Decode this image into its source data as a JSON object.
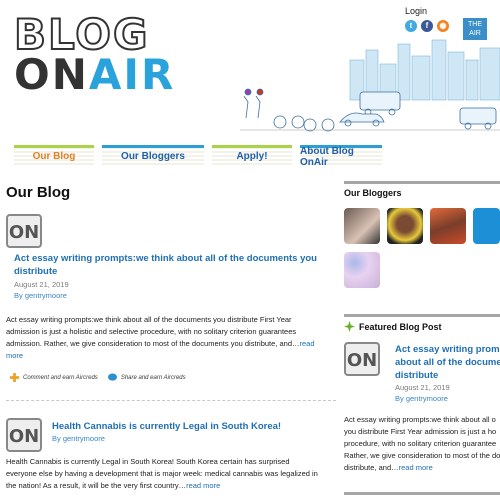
{
  "header": {
    "logo_line1": "BLOG",
    "logo_on": "ON",
    "logo_air": "AIR",
    "login_label": "Login",
    "social": [
      "twitter-icon",
      "facebook-icon",
      "rss-icon"
    ],
    "badge_line1": "THE",
    "badge_line2": "AIR"
  },
  "nav": {
    "tabs": [
      "Our Blog",
      "Our Bloggers",
      "Apply!",
      "About Blog OnAir"
    ]
  },
  "main": {
    "title": "Our Blog",
    "posts": [
      {
        "title_line1": "Act essay writing prompts:we think about all of the documents you",
        "title_line2": "distribute",
        "date": "August 21, 2019",
        "author": "By gentrymoore",
        "excerpt_lines": [
          "Act essay writing prompts:we think about all of the documents you distribute First Year",
          "admission is just a holistic and selective procedure, with no solitary criterion guarantees",
          "admission. Rather, we give consideration to most of the documents you distribute, and…"
        ],
        "read_more_inline": "read",
        "read_more_tail": "more",
        "comment_label": "Comment and earn Aircreds",
        "share_label": "Share and earn Aircreds"
      },
      {
        "title": "Health Cannabis is currently Legal in South Korea!",
        "author": "By gentrymoore",
        "excerpt_lines": [
          "Health Cannabis is currently Legal in South Korea! South Korea certain has surprised",
          "everyone else by having a development that is major week: medical cannabis was legalized in",
          "the nation! As a result, it will be the very first country…"
        ],
        "read_more": "read more"
      }
    ]
  },
  "sidebar": {
    "bloggers_title": "Our Bloggers",
    "featured_title": "Featured Blog Post",
    "featured": {
      "title_lines": [
        "Act essay writing promp",
        "about all of the docume",
        "distribute"
      ],
      "date": "August 21, 2019",
      "author": "By gentrymoore",
      "excerpt_lines": [
        "Act essay writing prompts:we think about all o",
        "you distribute First Year admission is just a ho",
        "procedure, with no solitary criterion guarantee",
        "Rather, we give consideration to most of the do",
        "distribute, and…"
      ],
      "read_more": "read more"
    }
  },
  "colors": {
    "accent_blue": "#2aa3dd",
    "link_blue": "#1f6fb5",
    "active_orange": "#e67e22",
    "tab_green": "#aad34a"
  }
}
